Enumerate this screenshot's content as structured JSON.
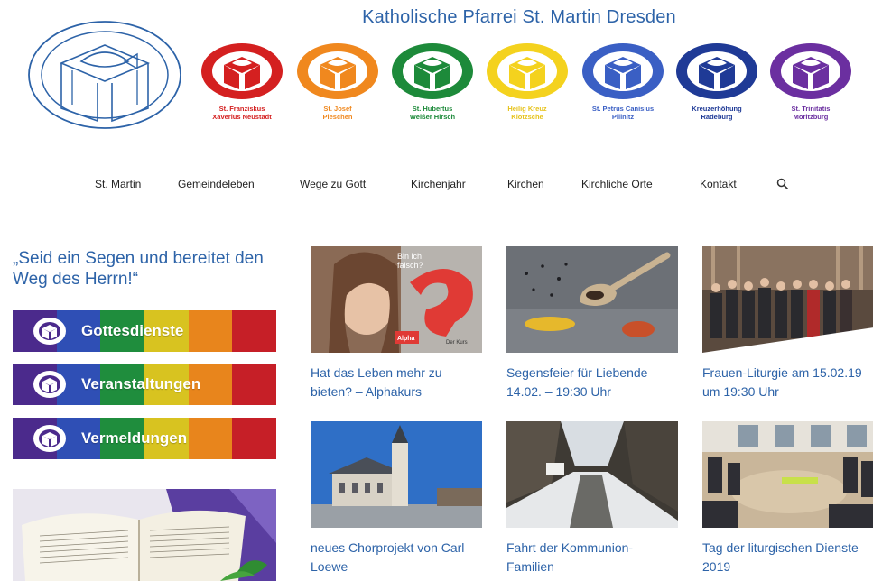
{
  "header": {
    "title": "Katholische Pfarrei St. Martin Dresden",
    "parishes": [
      {
        "line1": "St. Franziskus",
        "line2": "Xaverius Neustadt",
        "color": "#d42020",
        "text_color": "#d42020"
      },
      {
        "line1": "St. Josef",
        "line2": "Pieschen",
        "color": "#f0881e",
        "text_color": "#f0881e"
      },
      {
        "line1": "St. Hubertus",
        "line2": "Weißer Hirsch",
        "color": "#1d8a3a",
        "text_color": "#1d8a3a"
      },
      {
        "line1": "Heilig Kreuz",
        "line2": "Klotzsche",
        "color": "#f4d21e",
        "text_color": "#e6c21a"
      },
      {
        "line1": "St. Petrus Canisius",
        "line2": "Pillnitz",
        "color": "#3a5fc4",
        "text_color": "#3a5fc4"
      },
      {
        "line1": "Kreuzerhöhung",
        "line2": "Radeburg",
        "color": "#1f3a96",
        "text_color": "#1f3a96"
      },
      {
        "line1": "St. Trinitatis",
        "line2": "Moritzburg",
        "color": "#6b2fa0",
        "text_color": "#6b2fa0"
      }
    ]
  },
  "nav": {
    "items": [
      "St. Martin",
      "Gemeindeleben",
      "Wege zu Gott",
      "Kirchenjahr",
      "Kirchen",
      "Kirchliche Orte",
      "Kontakt"
    ],
    "search_icon": "search-icon"
  },
  "sidebar": {
    "quote": "„Seid ein Segen und bereitet den Weg des Herrn!“",
    "buttons": [
      {
        "label": "Gottesdienste"
      },
      {
        "label": "Veranstaltungen"
      },
      {
        "label": "Vermeldungen"
      }
    ],
    "rainbow": [
      "#4b2a8c",
      "#2f4fb5",
      "#1f8d3d",
      "#d8c320",
      "#e8851c",
      "#c61f27"
    ]
  },
  "posts": [
    {
      "title": "Hat das Leben mehr zu bieten? – Alphakurs",
      "image": "alpha-course-image"
    },
    {
      "title": "Segensfeier für Liebende 14.02. – 19:30 Uhr",
      "image": "spices-spoon-image"
    },
    {
      "title": "Frauen-Liturgie am 15.02.19 um 19:30 Uhr",
      "image": "women-group-image"
    },
    {
      "title": "neues Chorprojekt von Carl Loewe",
      "image": "church-building-image"
    },
    {
      "title": "Fahrt der Kommunion-Familien",
      "image": "winter-valley-image"
    },
    {
      "title": "Tag der liturgischen Dienste 2019",
      "image": "circle-meeting-image"
    }
  ],
  "alpha_image": {
    "top": "Bin ich",
    "top2": "falsch?",
    "badge": "Alpha",
    "tag": "Der Kurs"
  }
}
